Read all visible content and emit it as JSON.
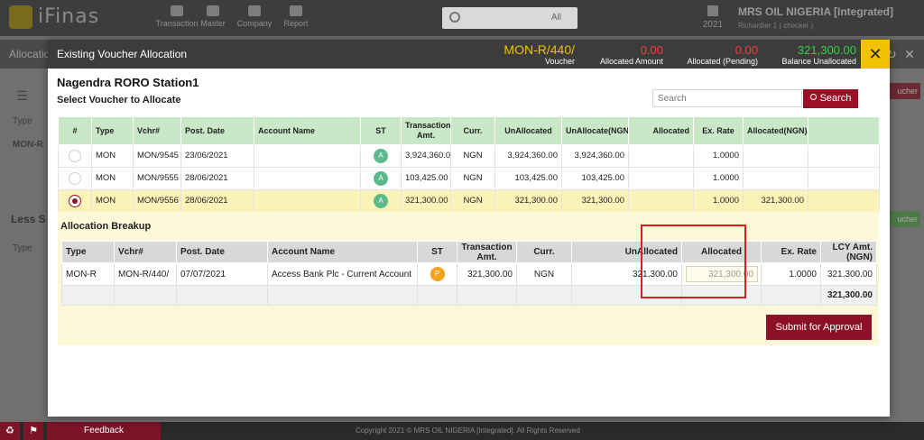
{
  "app": {
    "logo_text": "iFinas",
    "nav": [
      "Transaction",
      "Master",
      "Company",
      "Report"
    ],
    "search_filter": "All",
    "year": "2021",
    "company": "MRS OIL NIGERIA [Integrated]",
    "user": "Richardier 1 ( checker )",
    "subtitle": "Allocation",
    "bg_labels": {
      "type1": "Type",
      "mon_r": "MON-R",
      "less": "Less S",
      "type2": "Type",
      "voucher1": "ucher",
      "voucher2": "ucher"
    },
    "footer": {
      "feedback": "Feedback",
      "copyright": "Copyright 2021 © MRS OIL NIGERIA [Integrated]. All Rights Reserved"
    },
    "colors": {
      "brand": "#9b1026",
      "accent_yellow": "#f2c200"
    }
  },
  "modal": {
    "title": "Existing Voucher Allocation",
    "voucher_value": "MON-R/440/",
    "voucher_label": "Voucher",
    "allocated_amount_value": "0.00",
    "allocated_amount_label": "Allocated Amount",
    "allocated_pending_value": "0.00",
    "allocated_pending_label": "Allocated (Pending)",
    "balance_value": "321,300.00",
    "balance_label": "Balance Unallocated",
    "close_icon": "✕",
    "station": "Nagendra RORO Station1",
    "select_label": "Select Voucher to Allocate",
    "search_placeholder": "Search",
    "search_button": "Search",
    "voucher_table": {
      "headers": [
        "#",
        "Type",
        "Vchr#",
        "Post. Date",
        "Account Name",
        "ST",
        "Transaction Amt.",
        "Curr.",
        "UnAllocated",
        "UnAllocate(NGN)",
        "Allocated",
        "Ex. Rate",
        "Allocated(NGN)"
      ],
      "rows": [
        {
          "selected": false,
          "type": "MON",
          "vchr": "MON/9545",
          "date": "23/06/2021",
          "account": "",
          "st": "A",
          "amount": "3,924,360.00",
          "curr": "NGN",
          "unallocated": "3,924,360.00",
          "unallocated_ngn": "3,924,360.00",
          "allocated": "",
          "rate": "1.0000",
          "allocated_ngn": ""
        },
        {
          "selected": false,
          "type": "MON",
          "vchr": "MON/9555",
          "date": "28/06/2021",
          "account": "",
          "st": "A",
          "amount": "103,425.00",
          "curr": "NGN",
          "unallocated": "103,425.00",
          "unallocated_ngn": "103,425.00",
          "allocated": "",
          "rate": "1.0000",
          "allocated_ngn": ""
        },
        {
          "selected": true,
          "type": "MON",
          "vchr": "MON/9556",
          "date": "28/06/2021",
          "account": "",
          "st": "A",
          "amount": "321,300.00",
          "curr": "NGN",
          "unallocated": "321,300.00",
          "unallocated_ngn": "321,300.00",
          "allocated": "",
          "rate": "1.0000",
          "allocated_ngn": "321,300.00"
        }
      ]
    },
    "breakup": {
      "title": "Allocation Breakup",
      "headers": [
        "Type",
        "Vchr#",
        "Post. Date",
        "Account Name",
        "ST",
        "Transaction Amt.",
        "Curr.",
        "UnAllocated",
        "Allocated",
        "Ex. Rate",
        "LCY Amt. (NGN)"
      ],
      "row": {
        "type": "MON-R",
        "vchr": "MON-R/440/",
        "date": "07/07/2021",
        "account": "Access Bank Plc - Current Account",
        "st": "P",
        "amount": "321,300.00",
        "curr": "NGN",
        "unallocated": "321,300.00",
        "allocated": "321,300.00",
        "rate": "1.0000",
        "lcy": "321,300.00"
      },
      "total": "321,300.00",
      "submit_button": "Submit for Approval"
    }
  }
}
